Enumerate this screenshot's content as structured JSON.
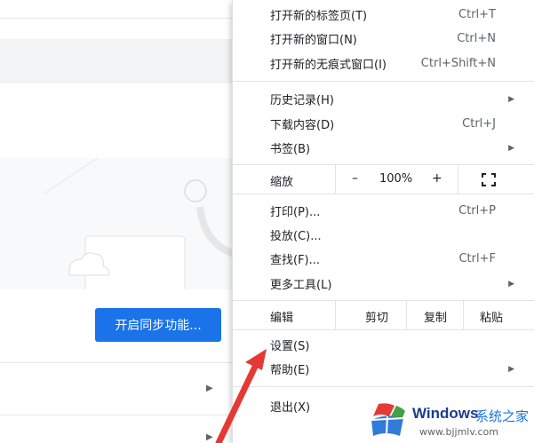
{
  "background": {
    "sync_button": "开启同步功能..."
  },
  "menu": {
    "group1": [
      {
        "label": "打开新的标签页(T)",
        "shortcut": "Ctrl+T"
      },
      {
        "label": "打开新的窗口(N)",
        "shortcut": "Ctrl+N"
      },
      {
        "label": "打开新的无痕式窗口(I)",
        "shortcut": "Ctrl+Shift+N"
      }
    ],
    "group2": [
      {
        "label": "历史记录(H)",
        "shortcut": ""
      },
      {
        "label": "下载内容(D)",
        "shortcut": "Ctrl+J"
      },
      {
        "label": "书签(B)",
        "shortcut": ""
      }
    ],
    "zoom": {
      "label": "缩放",
      "minus": "–",
      "value": "100%",
      "plus": "+"
    },
    "group3": [
      {
        "label": "打印(P)...",
        "shortcut": "Ctrl+P"
      },
      {
        "label": "投放(C)...",
        "shortcut": ""
      },
      {
        "label": "查找(F)...",
        "shortcut": "Ctrl+F"
      },
      {
        "label": "更多工具(L)",
        "shortcut": ""
      }
    ],
    "edit": {
      "label": "编辑",
      "cut": "剪切",
      "copy": "复制",
      "paste": "粘贴"
    },
    "group4": [
      {
        "label": "设置(S)"
      },
      {
        "label": "帮助(E)"
      }
    ],
    "exit": {
      "label": "退出(X)"
    }
  },
  "icons": [
    "submenu-arrow-icon",
    "fullscreen-icon",
    "red-arrow-annotation",
    "windows-logo-icon"
  ],
  "watermark": {
    "title": "Windows",
    "cn": "系统之家",
    "url": "www.bjjmlv.com"
  },
  "colors": {
    "accent": "#1a73e8",
    "annotation": "#e53935"
  }
}
